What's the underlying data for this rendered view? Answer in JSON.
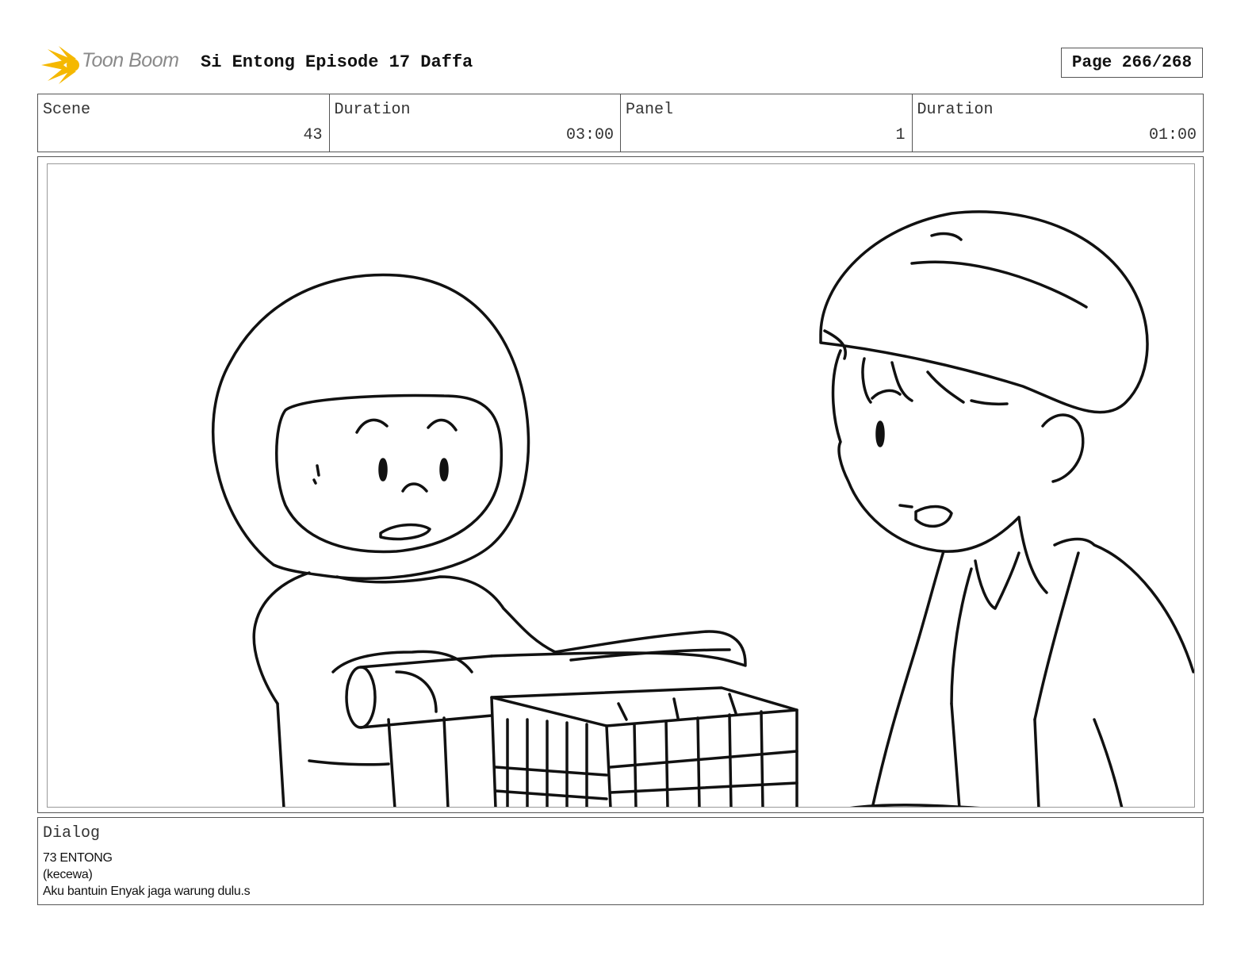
{
  "header": {
    "logo_text": "Toon Boom",
    "title": "Si Entong Episode 17 Daffa",
    "page": "Page 266/268"
  },
  "info": {
    "scene_label": "Scene",
    "scene_value": "43",
    "scene_duration_label": "Duration",
    "scene_duration_value": "03:00",
    "panel_label": "Panel",
    "panel_value": "1",
    "panel_duration_label": "Duration",
    "panel_duration_value": "01:00"
  },
  "dialog": {
    "label": "Dialog",
    "lines": [
      "73 ENTONG",
      "(kecewa)",
      "Aku bantuin Enyak jaga warung dulu.s"
    ]
  },
  "colors": {
    "logo_star": "#f5b800",
    "logo_text": "#8a8a8a",
    "border": "#555555",
    "ink": "#111111"
  }
}
